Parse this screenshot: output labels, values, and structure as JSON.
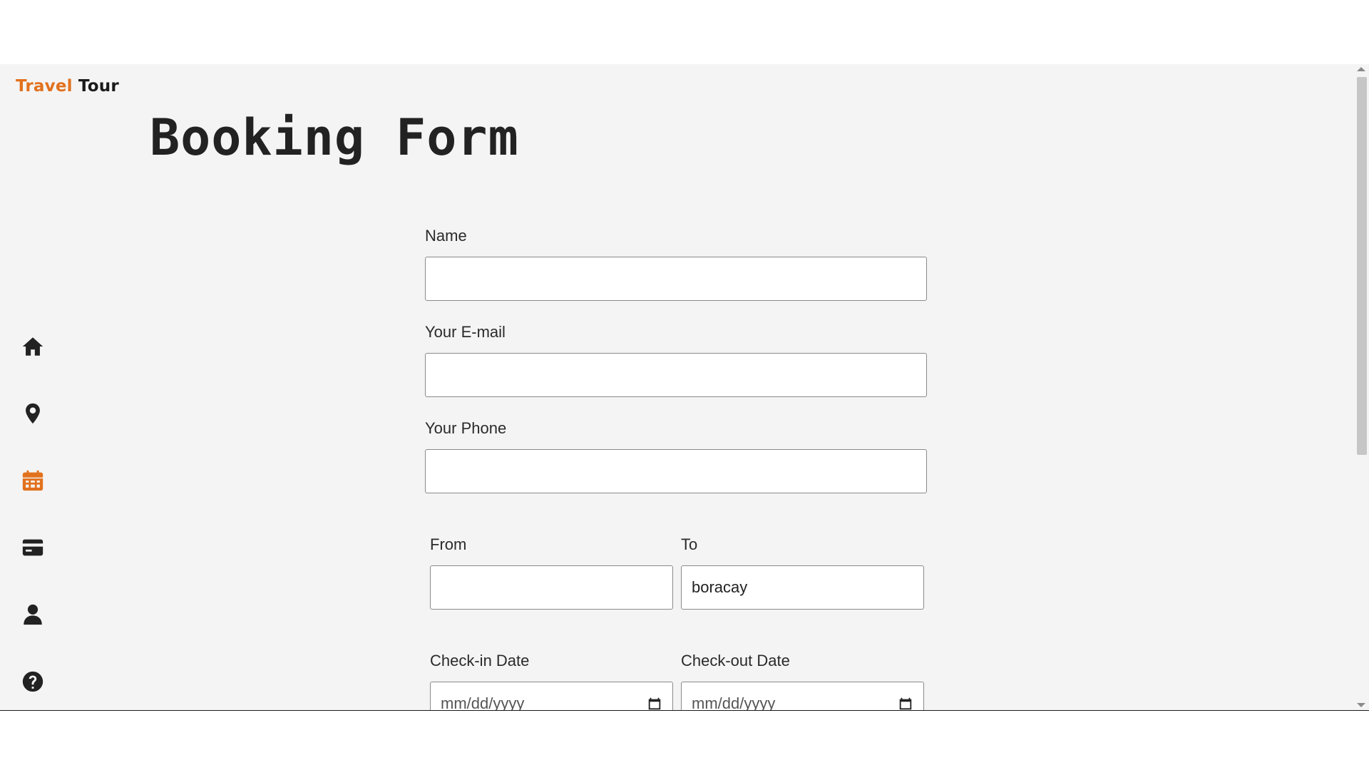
{
  "app": {
    "logo_part1": "Travel",
    "logo_part2": "Tour",
    "brand_color": "#e2711d"
  },
  "page": {
    "title": "Booking Form"
  },
  "sidebar": {
    "items": [
      {
        "icon": "home-icon",
        "active": false
      },
      {
        "icon": "location-pin-icon",
        "active": false
      },
      {
        "icon": "calendar-icon",
        "active": true
      },
      {
        "icon": "credit-card-icon",
        "active": false
      },
      {
        "icon": "user-icon",
        "active": false
      },
      {
        "icon": "help-icon",
        "active": false
      }
    ]
  },
  "form": {
    "name_label": "Name",
    "name_value": "",
    "email_label": "Your E-mail",
    "email_value": "",
    "phone_label": "Your Phone",
    "phone_value": "",
    "from_label": "From",
    "from_value": "",
    "to_label": "To",
    "to_value": "boracay",
    "checkin_label": "Check-in Date",
    "checkin_placeholder": "mm/dd/yyyy",
    "checkout_label": "Check-out Date",
    "checkout_placeholder": "mm/dd/yyyy"
  }
}
